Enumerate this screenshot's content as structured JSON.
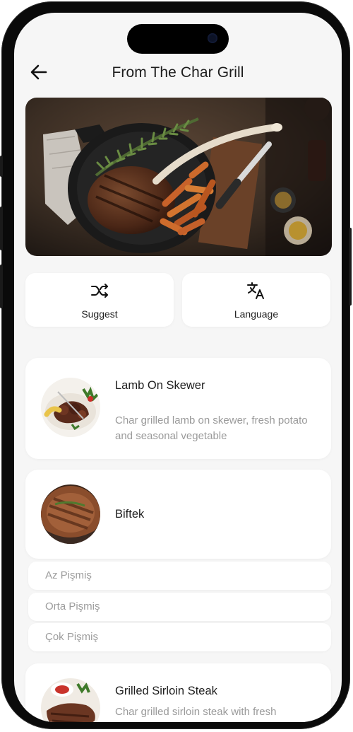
{
  "header": {
    "title": "From The Char Grill",
    "back_icon": "arrow-left-icon"
  },
  "actions": [
    {
      "label": "Suggest",
      "icon": "shuffle-icon"
    },
    {
      "label": "Language",
      "icon": "translate-icon"
    }
  ],
  "menu": [
    {
      "name": "Lamb On Skewer",
      "description": "Char grilled lamb on skewer, fresh potato and seasonal vegetable"
    },
    {
      "name": "Biftek",
      "options": [
        "Az Pişmiş",
        "Orta Pişmiş",
        "Çok Pişmiş"
      ]
    },
    {
      "name": "Grilled Sirloin Steak",
      "description": "Char grilled sirloin steak with fresh"
    }
  ],
  "colors": {
    "background": "#f6f6f6",
    "card": "#ffffff",
    "text": "#1e1e1e",
    "muted": "#9a9a9a",
    "frame": "#0a0a0a"
  }
}
